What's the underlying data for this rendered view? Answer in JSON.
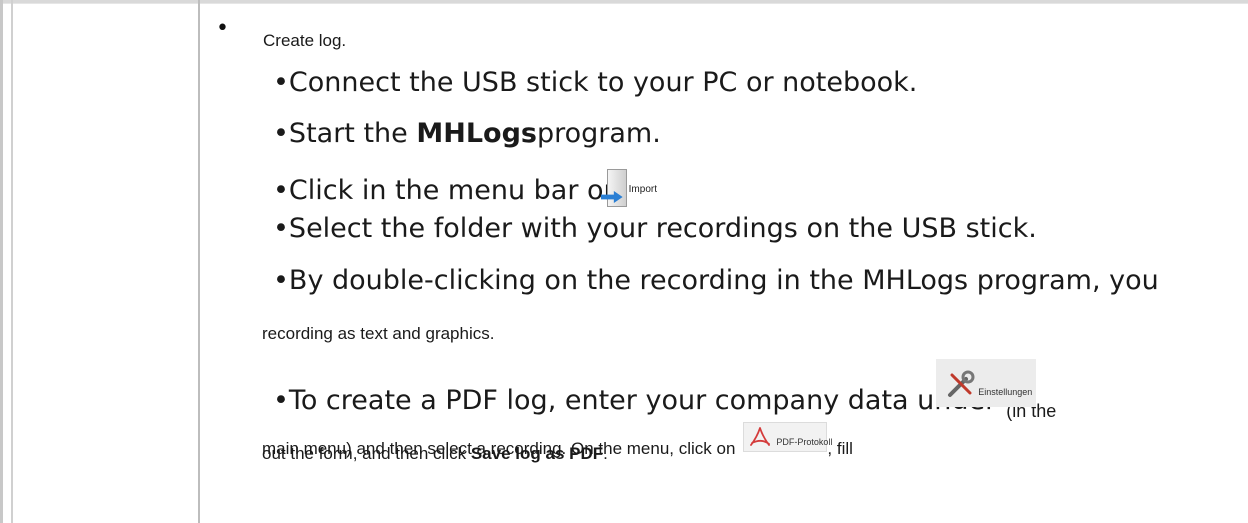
{
  "intro": "Create log.",
  "steps": {
    "s1": "•Connect the USB stick to your PC or notebook.",
    "s2_pre": "•Start the ",
    "s2_bold": "MHLogs",
    "s2_post": "program.",
    "s3": "•Click in the menu bar on",
    "s4": "•Select the folder with your recordings on the USB stick.",
    "s5": "•By double-clicking on the recording in the MHLogs program, you",
    "s5_wrap": "recording as text and graphics.",
    "s6_pre": "•To create a PDF log, enter your company data under",
    "s6_post": "(in the",
    "s6_wrap1_pre": "main menu) and then select a recording. On the menu, click on",
    "s6_wrap1_post": ", fill",
    "s6_wrap2_pre": "out the form, and then click ",
    "s6_wrap2_bold": "Save log as PDF",
    "s6_wrap2_post": "."
  },
  "icons": {
    "import": {
      "name": "import-icon",
      "label": "Import"
    },
    "settings": {
      "name": "settings-tools-icon",
      "label": "Einstellungen"
    },
    "pdf": {
      "name": "pdf-protocol-icon",
      "label": "PDF-Protokoll"
    }
  }
}
